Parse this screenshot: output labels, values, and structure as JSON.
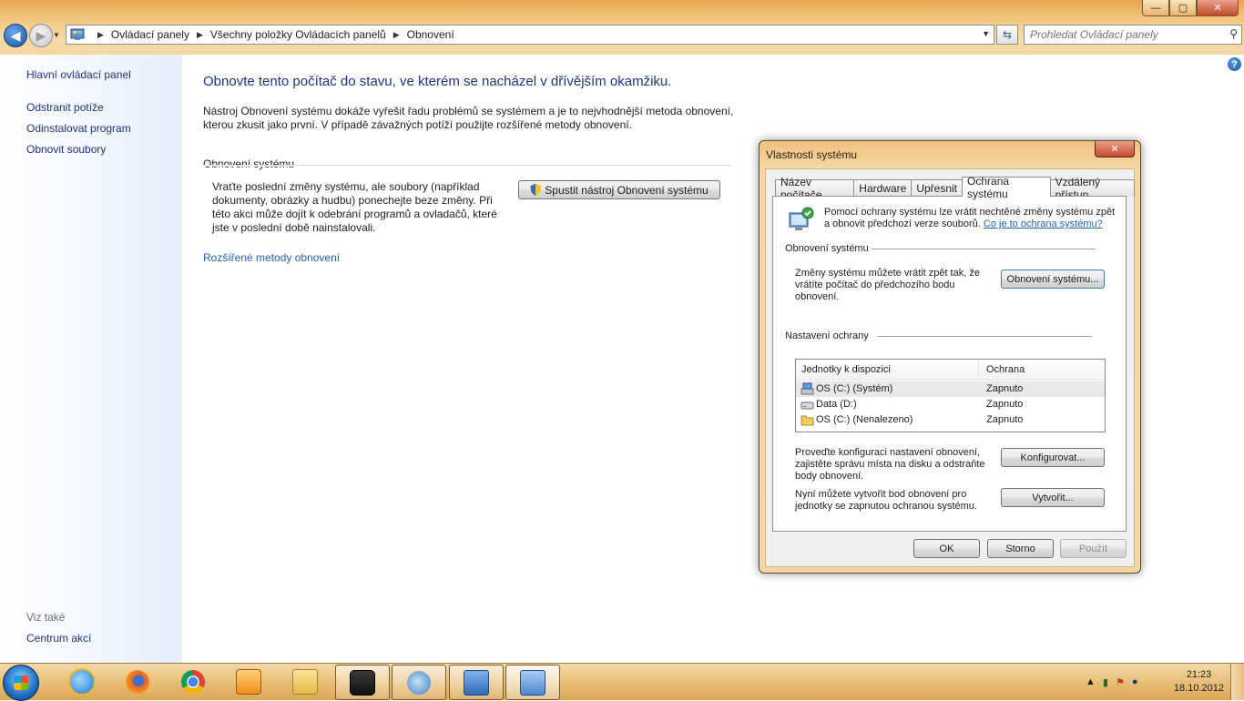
{
  "window": {
    "controls": {
      "minimize": "—",
      "maximize": "▢",
      "close": "✕"
    }
  },
  "nav": {
    "back_glyph": "◀",
    "forward_glyph": "▶",
    "breadcrumbs": [
      "Ovládací panely",
      "Všechny položky Ovládacích panelů",
      "Obnovení"
    ],
    "search_placeholder": "Prohledat Ovládací panely"
  },
  "sidebar": {
    "home": "Hlavní ovládací panel",
    "links": [
      "Odstranit potíže",
      "Odinstalovat program",
      "Obnovit soubory"
    ],
    "see_also_heading": "Viz také",
    "see_also_links": [
      "Centrum akcí"
    ]
  },
  "main": {
    "title": "Obnovte tento počítač do stavu, ve kterém se nacházel v dřívějším okamžiku.",
    "intro": "Nástroj Obnovení systému dokáže vyřešit řadu problémů se systémem a je to nejvhodnější metoda obnovení, kterou zkusit jako první. V případě závažných potíží použijte rozšířené metody obnovení.",
    "group_heading": "Obnovení systému",
    "group_text": "Vraťte poslední změny systému, ale soubory (například dokumenty, obrázky a hudbu) ponechejte beze změny. Při této akci může dojít k odebrání programů a ovladačů, které jste v poslední době nainstalovali.",
    "run_button": "Spustit nástroj Obnovení systému",
    "advanced_link": "Rozšířené metody obnovení",
    "help_glyph": "?"
  },
  "dialog": {
    "title": "Vlastnosti systému",
    "close_glyph": "✕",
    "tabs": [
      "Název počítače",
      "Hardware",
      "Upřesnit",
      "Ochrana systému",
      "Vzdálený přístup"
    ],
    "active_tab": "Ochrana systému",
    "intro": "Pomocí ochrany systému lze vrátit nechtěné změny systému zpět a obnovit předchozí verze souborů.",
    "intro_link": "Co je to ochrana systému?",
    "restore_heading": "Obnovení systému",
    "restore_text": "Změny systému můžete vrátit zpět tak, že vrátíte počítač do předchozího bodu obnovení.",
    "restore_button": "Obnovení systému...",
    "protection_heading": "Nastavení ochrany",
    "drives_columns": [
      "Jednotky k dispozici",
      "Ochrana"
    ],
    "drives": [
      {
        "name": "OS (C:) (Systém)",
        "status": "Zapnuto",
        "icon": "system-drive-icon"
      },
      {
        "name": "Data (D:)",
        "status": "Zapnuto",
        "icon": "drive-icon"
      },
      {
        "name": "OS (C:) (Nenalezeno)",
        "status": "Zapnuto",
        "icon": "folder-drive-icon"
      }
    ],
    "configure_text": "Proveďte konfiguraci nastavení obnovení, zajistěte správu místa na disku a odstraňte body obnovení.",
    "configure_button": "Konfigurovat...",
    "create_text": "Nyní můžete vytvořit bod obnovení pro jednotky se zapnutou ochranou systému.",
    "create_button": "Vytvořit...",
    "ok_button": "OK",
    "cancel_button": "Storno",
    "apply_button": "Použít"
  },
  "taskbar": {
    "apps": [
      "internet-explorer-icon",
      "firefox-icon",
      "chrome-icon",
      "media-player-icon",
      "file-explorer-icon",
      "steam-icon",
      "system-tool-icon",
      "control-panel-icon",
      "system-properties-icon"
    ],
    "clock_time": "21:23",
    "clock_date": "18.10.2012"
  },
  "colors": {
    "frame": "#f3d8a6",
    "link": "#1e3287",
    "accent_link": "#1e62b8",
    "title_blue": "#1e3287"
  }
}
